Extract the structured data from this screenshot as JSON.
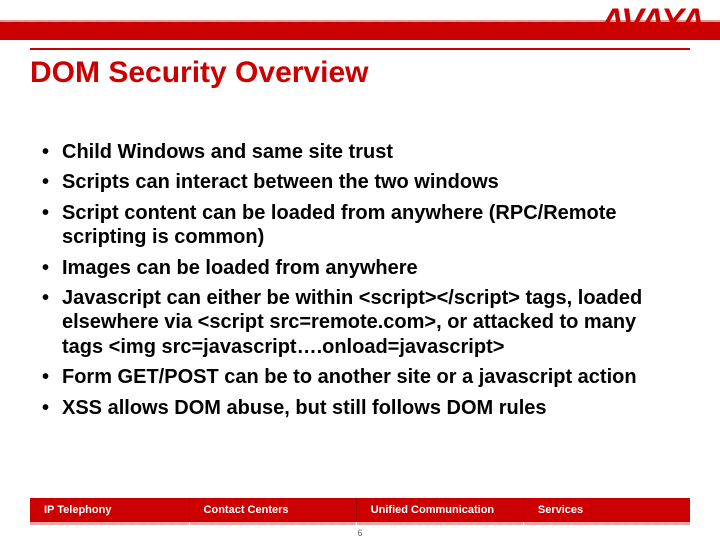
{
  "brand": {
    "name": "AVAYA",
    "color": "#cc0000"
  },
  "title": "DOM Security Overview",
  "bullets": [
    "Child Windows and same site trust",
    "Scripts can interact between the two windows",
    "Script content can be loaded from anywhere (RPC/Remote scripting is common)",
    "Images can be loaded from anywhere",
    "Javascript can either be within <script></script> tags, loaded elsewhere via <script src=remote.com>, or attacked to many tags <img src=javascript….onload=javascript>",
    "Form GET/POST can be to another site or a javascript action",
    "XSS allows DOM abuse, but still follows DOM rules"
  ],
  "footer": {
    "items": [
      "IP Telephony",
      "Contact Centers",
      "Unified Communication",
      "Services"
    ]
  },
  "page_number": "6"
}
